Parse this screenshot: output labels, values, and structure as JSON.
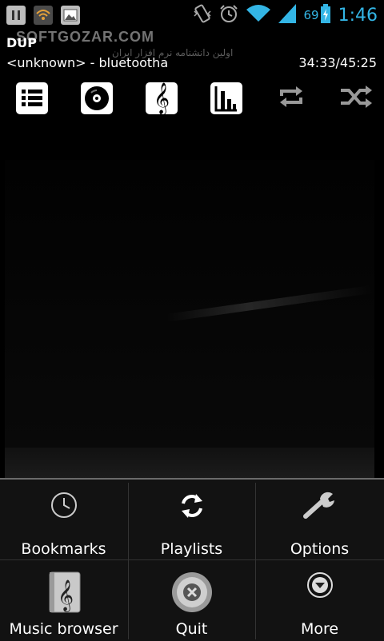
{
  "status_bar": {
    "icons_left": [
      "pause-icon",
      "wifi-hotspot-icon",
      "image-icon"
    ],
    "icons_right": [
      "vibrate-icon",
      "alarm-icon",
      "wifi-icon",
      "signal-icon"
    ],
    "battery": "69",
    "time": "1:46"
  },
  "watermark": {
    "text": "SOFTGOZAR.COM",
    "subtext": "اولین دانشنامه نرم افزار ایران"
  },
  "track": {
    "title": "DUP",
    "artist": "<unknown> - bluetootha",
    "time": "34:33/45:25"
  },
  "toolbar": {
    "items": [
      "list-icon",
      "disc-icon",
      "treble-clef-icon",
      "equalizer-icon",
      "repeat-icon",
      "shuffle-icon"
    ]
  },
  "menu": {
    "items": [
      {
        "label": "Bookmarks",
        "icon": "clock-icon"
      },
      {
        "label": "Playlists",
        "icon": "sync-icon"
      },
      {
        "label": "Options",
        "icon": "wrench-icon"
      },
      {
        "label": "Music browser",
        "icon": "music-book-icon"
      },
      {
        "label": "Quit",
        "icon": "close-circle-icon"
      },
      {
        "label": "More",
        "icon": "chevron-down-circle-icon"
      }
    ]
  },
  "colors": {
    "accent": "#33b5e5",
    "background": "#000000"
  }
}
